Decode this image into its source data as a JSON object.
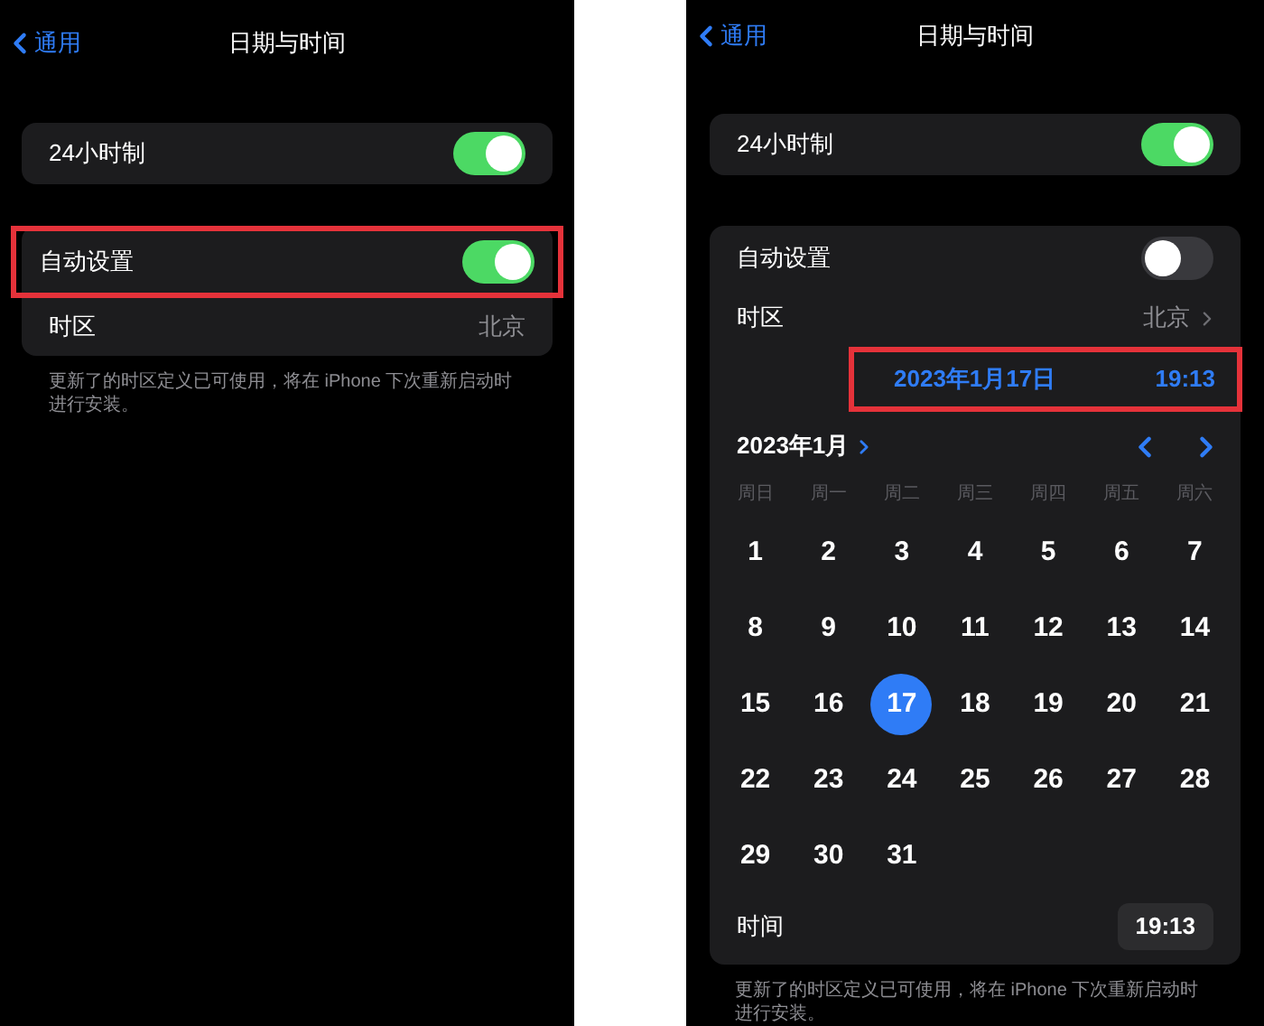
{
  "panels": [
    {
      "header": {
        "back": "通用",
        "title": "日期与时间"
      },
      "hour24": {
        "label": "24小时制",
        "on": true
      },
      "auto": {
        "label": "自动设置",
        "on": true,
        "highlighted": true
      },
      "timezone": {
        "label": "时区",
        "value": "北京",
        "chevron": false
      },
      "footnote": "更新了的时区定义已可使用，将在 iPhone 下次重新启动时进行安装。"
    },
    {
      "header": {
        "back": "通用",
        "title": "日期与时间"
      },
      "hour24": {
        "label": "24小时制",
        "on": true
      },
      "auto": {
        "label": "自动设置",
        "on": false,
        "highlighted": false
      },
      "timezone": {
        "label": "时区",
        "value": "北京",
        "chevron": true
      },
      "date_time": {
        "date": "2023年1月17日",
        "time": "19:13",
        "highlighted": true
      },
      "calendar": {
        "month": "2023年1月",
        "weekdays": [
          "周日",
          "周一",
          "周二",
          "周三",
          "周四",
          "周五",
          "周六"
        ],
        "days": [
          {
            "label": "1",
            "selected": false
          },
          {
            "label": "2",
            "selected": false
          },
          {
            "label": "3",
            "selected": false
          },
          {
            "label": "4",
            "selected": false
          },
          {
            "label": "5",
            "selected": false
          },
          {
            "label": "6",
            "selected": false
          },
          {
            "label": "7",
            "selected": false
          },
          {
            "label": "8",
            "selected": false
          },
          {
            "label": "9",
            "selected": false
          },
          {
            "label": "10",
            "selected": false
          },
          {
            "label": "11",
            "selected": false
          },
          {
            "label": "12",
            "selected": false
          },
          {
            "label": "13",
            "selected": false
          },
          {
            "label": "14",
            "selected": false
          },
          {
            "label": "15",
            "selected": false
          },
          {
            "label": "16",
            "selected": false
          },
          {
            "label": "17",
            "selected": true
          },
          {
            "label": "18",
            "selected": false
          },
          {
            "label": "19",
            "selected": false
          },
          {
            "label": "20",
            "selected": false
          },
          {
            "label": "21",
            "selected": false
          },
          {
            "label": "22",
            "selected": false
          },
          {
            "label": "23",
            "selected": false
          },
          {
            "label": "24",
            "selected": false
          },
          {
            "label": "25",
            "selected": false
          },
          {
            "label": "26",
            "selected": false
          },
          {
            "label": "27",
            "selected": false
          },
          {
            "label": "28",
            "selected": false
          },
          {
            "label": "29",
            "selected": false
          },
          {
            "label": "30",
            "selected": false
          },
          {
            "label": "31",
            "selected": false
          }
        ]
      },
      "time": {
        "label": "时间",
        "value": "19:13"
      },
      "footnote": "更新了的时区定义已可使用，将在 iPhone 下次重新启动时进行安装。"
    }
  ]
}
